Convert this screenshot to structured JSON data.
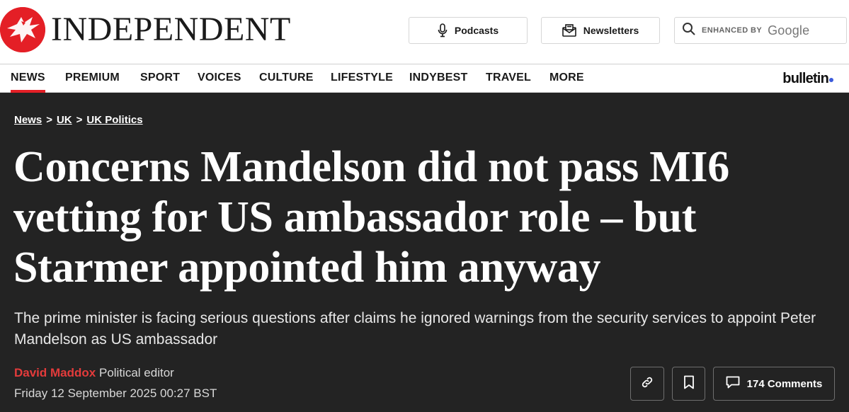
{
  "masthead": {
    "wordmark": "INDEPENDENT",
    "podcasts_label": "Podcasts",
    "newsletters_label": "Newsletters",
    "search_enhanced_label": "ENHANCED BY",
    "search_google_label": "Google",
    "brand_color": "#e41f26"
  },
  "nav": {
    "items": [
      {
        "label": "NEWS",
        "active": true
      },
      {
        "label": "PREMIUM"
      },
      {
        "label": "SPORT"
      },
      {
        "label": "VOICES"
      },
      {
        "label": "CULTURE"
      },
      {
        "label": "LIFESTYLE"
      },
      {
        "label": "INDYBEST"
      },
      {
        "label": "TRAVEL"
      },
      {
        "label": "MORE"
      }
    ],
    "bulletin_label": "bulletin"
  },
  "article": {
    "breadcrumb": [
      "News",
      "UK",
      "UK Politics"
    ],
    "breadcrumb_separator": ">",
    "headline": "Concerns Mandelson did not pass MI6 vetting for US ambassador role – but Starmer appointed him anyway",
    "standfirst": "The prime minister is facing serious questions after claims he ignored warnings from the security services to appoint Peter Mandelson as US ambassador",
    "author": "David Maddox",
    "author_role": "Political editor",
    "date": "Friday 12 September 2025 00:27 BST",
    "comments_label": "174 Comments",
    "background_color": "#232323",
    "author_color": "#e33b3b"
  },
  "icons": {
    "logo": "eagle-logo-icon",
    "podcasts": "microphone-icon",
    "newsletters": "newsletter-icon",
    "search": "search-icon",
    "share": "link-icon",
    "save": "bookmark-icon",
    "comments": "comment-icon"
  }
}
